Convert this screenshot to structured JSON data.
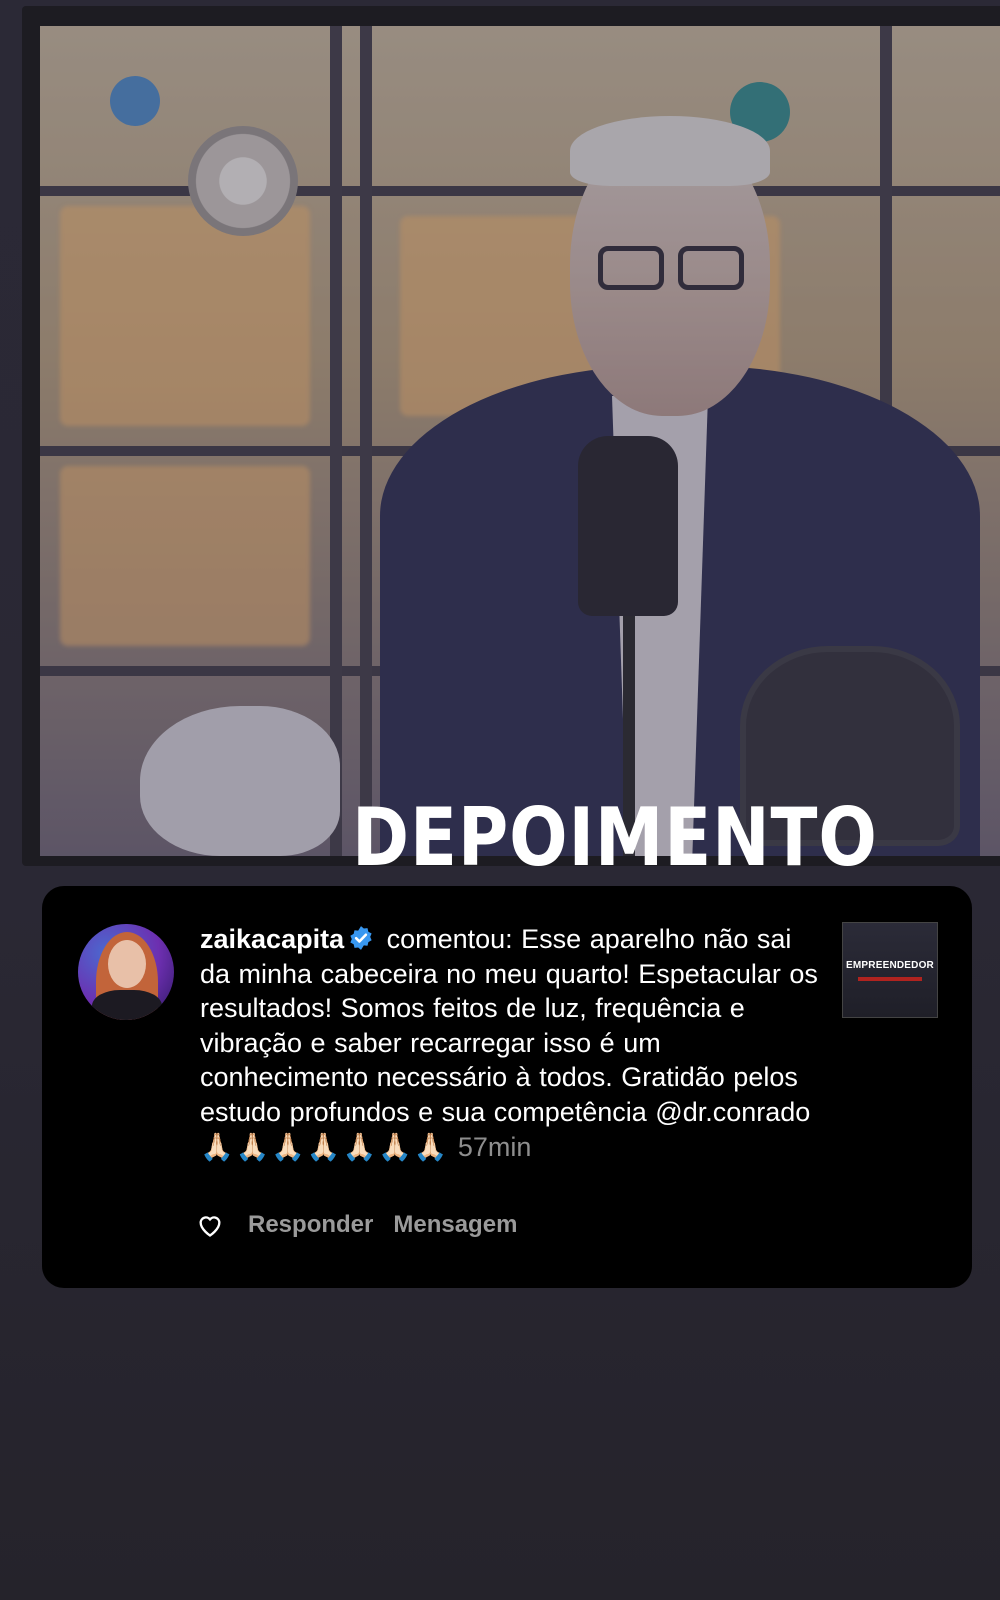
{
  "story": {
    "headline": "DEPOIMENTO"
  },
  "comment": {
    "username": "zaikacapita",
    "verified": true,
    "action_text": " comentou: ",
    "text": "Esse aparelho não sai da minha cabeceira no meu quarto! Espetacular os resultados! Somos feitos de luz, frequência e vibração e saber recarregar isso é um conhecimento necessário à todos. Gratidão pelos estudo profundos e sua competência @dr.conrado",
    "emojis": "🙏🏻🙏🏻🙏🏻🙏🏻🙏🏻🙏🏻🙏🏻",
    "time": "57min",
    "reply_label": "Responder",
    "message_label": "Mensagem",
    "thumbnail_text": "EMPREENDEDOR"
  },
  "colors": {
    "verified_blue": "#3897f0",
    "card_background": "#000000",
    "muted_text": "#8e8e8e"
  },
  "icons": {
    "like": "heart-icon",
    "verified": "verified-badge-icon"
  }
}
